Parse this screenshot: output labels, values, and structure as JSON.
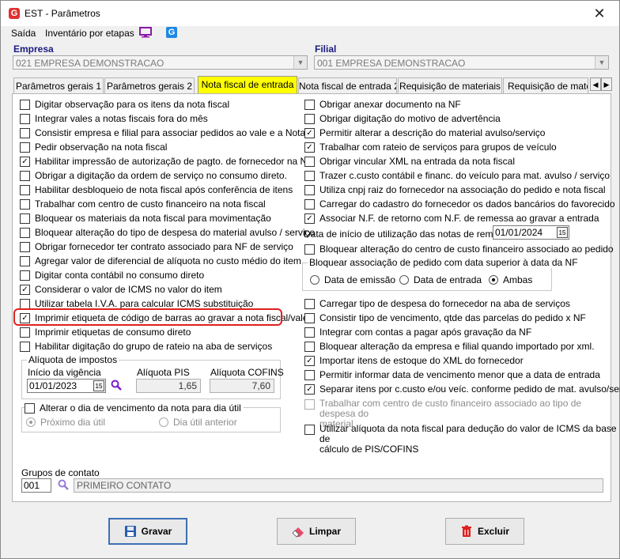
{
  "window": {
    "title": "EST - Parâmetros",
    "close_glyph": "✕"
  },
  "menu": {
    "items": [
      "Saída",
      "Inventário por etapas"
    ]
  },
  "empresa": {
    "label": "Empresa",
    "value": "021 EMPRESA DEMONSTRACAO"
  },
  "filial": {
    "label": "Filial",
    "value": "001 EMPRESA DEMONSTRACAO"
  },
  "tabs": [
    "Parâmetros gerais 1",
    "Parâmetros gerais 2",
    "Nota fiscal de entrada",
    "Nota fiscal de entrada 2",
    "Requisição de materiais",
    "Requisição de materi"
  ],
  "active_tab": "Nota fiscal de entrada",
  "left_checks": [
    {
      "label": "Digitar observação para os itens da nota fiscal",
      "checked": false
    },
    {
      "label": "Integrar vales a notas fiscais fora do mês",
      "checked": false
    },
    {
      "label": "Consistir empresa e filial para associar pedidos ao vale e a Nota F.",
      "checked": false
    },
    {
      "label": "Pedir observação na nota fiscal",
      "checked": false
    },
    {
      "label": "Habilitar impressão de autorização de pagto. de fornecedor na NF",
      "checked": true
    },
    {
      "label": "Obrigar a digitação da ordem de serviço no consumo direto.",
      "checked": false
    },
    {
      "label": "Habilitar desbloqueio de nota fiscal após conferência de itens",
      "checked": false
    },
    {
      "label": "Trabalhar com centro de custo financeiro na nota fiscal",
      "checked": false
    },
    {
      "label": "Bloquear os materiais da nota fiscal para movimentação",
      "checked": false
    },
    {
      "label": "Bloquear alteração do tipo de despesa do material avulso / serviço",
      "checked": false
    },
    {
      "label": "Obrigar fornecedor ter contrato associado para NF de serviço",
      "checked": false
    },
    {
      "label": "Agregar valor de diferencial de alíquota no custo médio do item",
      "checked": false
    },
    {
      "label": "Digitar conta contábil no consumo direto",
      "checked": false
    },
    {
      "label": "Considerar o valor de ICMS no valor do item",
      "checked": true
    },
    {
      "label": "Utilizar tabela I.V.A. para calcular ICMS substituição",
      "checked": false
    },
    {
      "label": "Imprimir etiqueta de código de barras ao gravar a nota fiscal/vale",
      "checked": true
    },
    {
      "label": "Imprimir etiquetas de consumo direto",
      "checked": false
    },
    {
      "label": "Habilitar digitação do grupo de rateio na aba de serviços",
      "checked": false
    }
  ],
  "aliquota": {
    "title": "Alíquota de impostos",
    "inicio_label": "Início da vigência",
    "inicio_value": "01/01/2023",
    "pis_label": "Alíquota PIS",
    "pis_value": "1,65",
    "cofins_label": "Alíquota COFINS",
    "cofins_value": "7,60"
  },
  "vencimento": {
    "label": "Alterar o dia de vencimento da nota para dia útil",
    "opt1": "Próximo dia útil",
    "opt2": "Dia útil anterior"
  },
  "right_checks_top": [
    {
      "label": "Obrigar anexar documento na NF",
      "checked": false
    },
    {
      "label": "Obrigar digitação do motivo de advertência",
      "checked": false
    },
    {
      "label": "Permitir alterar a descrição do material avulso/serviço",
      "checked": true
    },
    {
      "label": "Trabalhar com rateio de serviços para grupos de veículo",
      "checked": true
    },
    {
      "label": "Obrigar vincular XML na entrada da nota fiscal",
      "checked": false
    },
    {
      "label": "Trazer c.custo contábil e financ. do veículo para mat. avulso / serviço",
      "checked": false
    },
    {
      "label": "Utiliza cnpj raiz do fornecedor na associação do pedido e nota fiscal",
      "checked": false
    },
    {
      "label": "Carregar do cadastro do fornecedor os dados bancários do favorecido",
      "checked": false
    },
    {
      "label": "Associar N.F. de retorno com N.F. de remessa ao gravar a entrada",
      "checked": true
    }
  ],
  "data_inicio": {
    "label": "Data de início de utilização das notas de remessa",
    "value": "01/01/2024"
  },
  "bloquear_cc": "Bloquear alteração do centro de custo financeiro associado ao pedido",
  "bloq_assoc": {
    "title": "Bloquear associação de pedido com data superior à data da NF",
    "opts": [
      "Data de emissão",
      "Data de entrada",
      "Ambas"
    ],
    "selected": "Ambas"
  },
  "right_checks_bottom": [
    {
      "label": "Carregar tipo de despesa do fornecedor na aba de serviços",
      "checked": false
    },
    {
      "label": "Consistir tipo de vencimento, qtde das parcelas do pedido x NF",
      "checked": false
    },
    {
      "label": "Integrar com contas a pagar após gravação da NF",
      "checked": false
    },
    {
      "label": "Bloquear alteração da empresa e filial quando importado por xml.",
      "checked": false
    },
    {
      "label": "Importar itens de estoque do XML do fornecedor",
      "checked": true
    },
    {
      "label": "Permitir informar data de vencimento menor que a data de entrada",
      "checked": false
    },
    {
      "label": "Separar itens por c.custo e/ou veíc. conforme pedido de mat. avulso/serviço",
      "checked": true
    }
  ],
  "disabled_check": {
    "line1": "Trabalhar com centro de custo financeiro associado ao tipo de despesa do",
    "line2": "material"
  },
  "aliq_check": {
    "line1": "Utilizar alíquota da nota fiscal para dedução do valor de ICMS da base de",
    "line2": "cálculo de PIS/COFINS"
  },
  "grupos": {
    "label": "Grupos de contato",
    "code": "001",
    "name": "PRIMEIRO CONTATO"
  },
  "buttons": {
    "gravar": "Gravar",
    "limpar": "Limpar",
    "excluir": "Excluir"
  },
  "colors": {
    "active_tab": "#ffff00",
    "highlight": "#e02020",
    "label_blue": "#1a1a80"
  }
}
